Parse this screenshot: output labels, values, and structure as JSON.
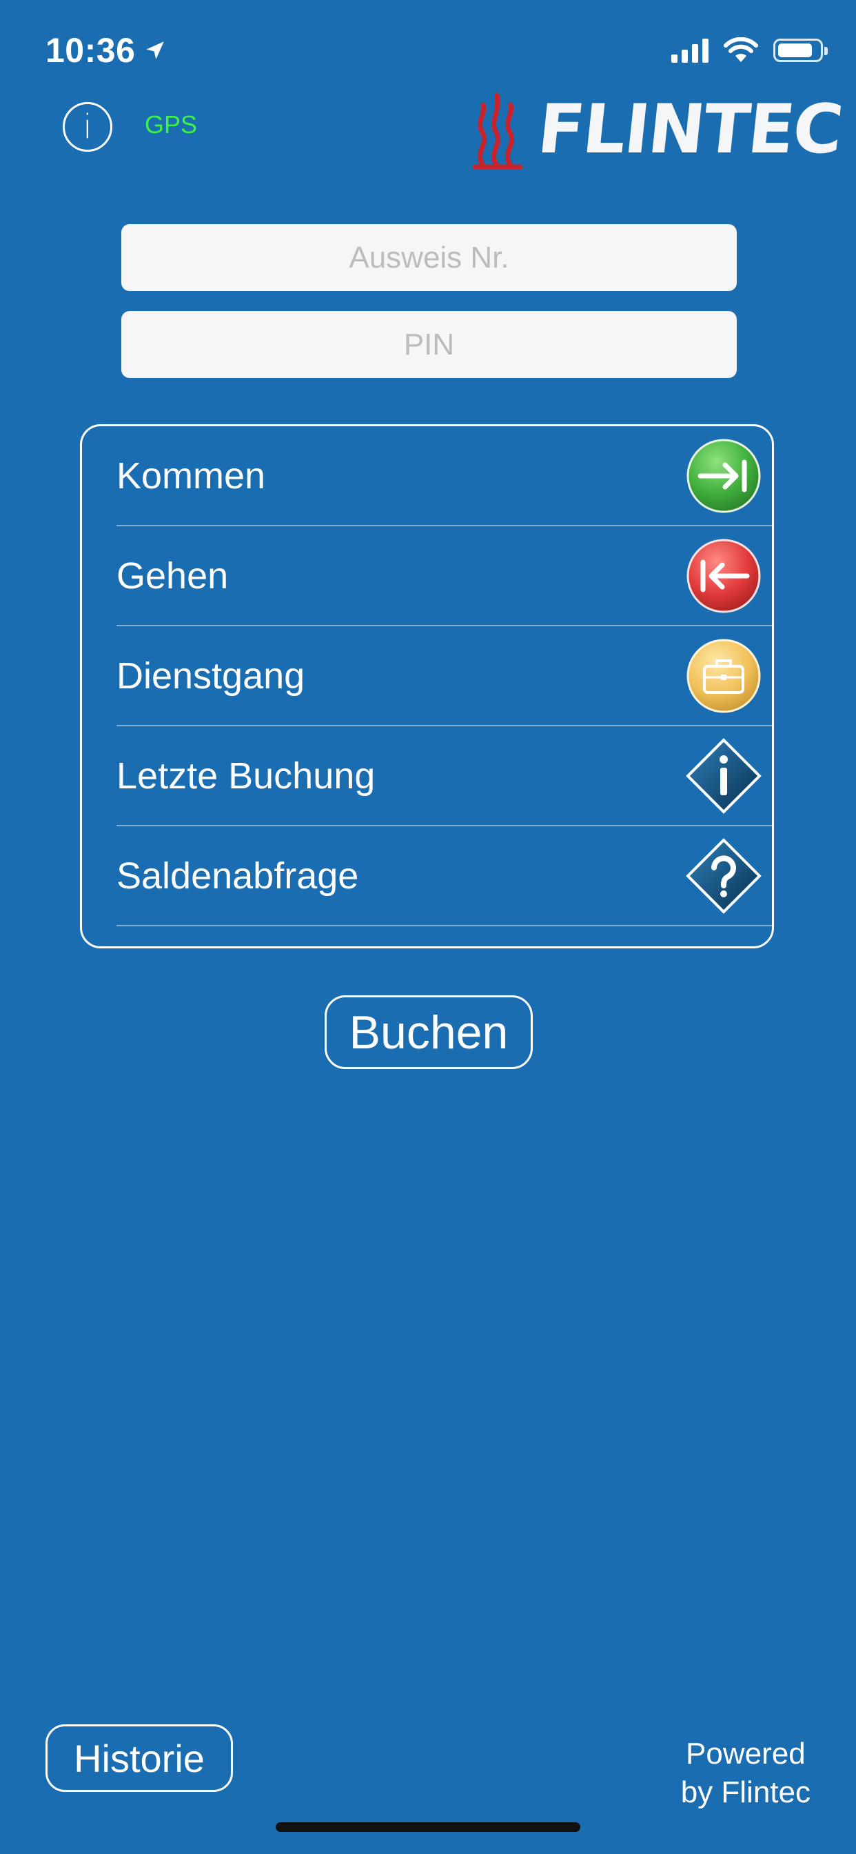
{
  "status_bar": {
    "time": "10:36",
    "icons": [
      "location-arrow-icon",
      "signal-icon",
      "wifi-icon",
      "battery-icon"
    ],
    "battery_level": 0.85
  },
  "header": {
    "info_icon_glyph": "i",
    "gps_label": "GPS",
    "logo_text": "FLINTEC",
    "gps_color": "#3ef04a",
    "logo_flame_color": "#c8232a"
  },
  "form": {
    "badge_placeholder": "Ausweis Nr.",
    "pin_placeholder": "PIN"
  },
  "actions": [
    {
      "label": "Kommen",
      "icon": "clock-in-icon",
      "color": "#3fae3c"
    },
    {
      "label": "Gehen",
      "icon": "clock-out-icon",
      "color": "#e03a3a"
    },
    {
      "label": "Dienstgang",
      "icon": "briefcase-icon",
      "color": "#f1c15a"
    },
    {
      "label": "Letzte Buchung",
      "icon": "info-diamond-icon",
      "color": "#0d3f66"
    },
    {
      "label": "Saldenabfrage",
      "icon": "question-diamond-icon",
      "color": "#0d3f66"
    }
  ],
  "buchen_label": "Buchen",
  "footer": {
    "historie_label": "Historie",
    "powered_line1": "Powered",
    "powered_line2": "by Flintec"
  },
  "colors": {
    "background": "#1a6db0",
    "accent_white": "#ffffff"
  }
}
